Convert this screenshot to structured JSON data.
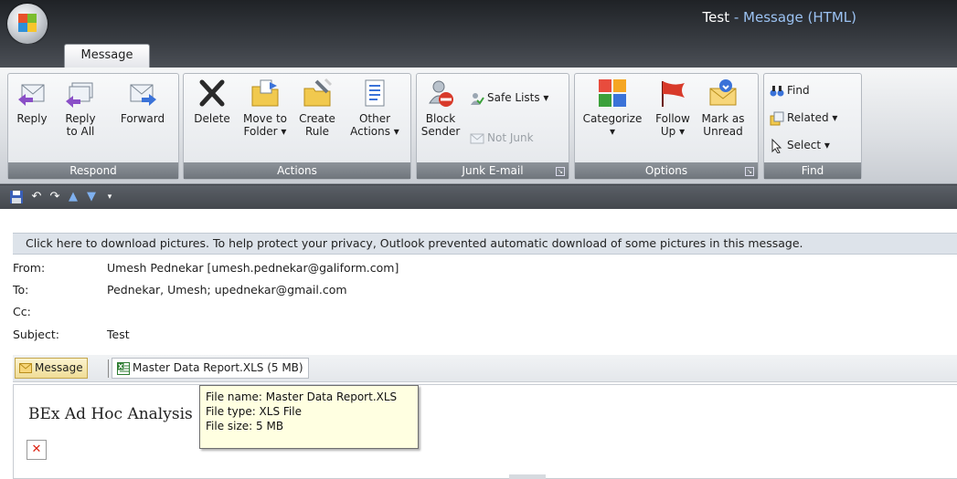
{
  "window": {
    "title_doc": "Test",
    "title_sep": " - ",
    "title_app": "Message (HTML)"
  },
  "tabs": [
    {
      "label": "Message"
    }
  ],
  "ribbon": {
    "groups": {
      "respond": {
        "label": "Respond",
        "reply": "Reply",
        "reply_all_1": "Reply",
        "reply_all_2": "to All",
        "forward": "Forward"
      },
      "actions": {
        "label": "Actions",
        "delete": "Delete",
        "move_1": "Move to",
        "move_2": "Folder ▾",
        "create_1": "Create",
        "create_2": "Rule",
        "other_1": "Other",
        "other_2": "Actions ▾"
      },
      "junk": {
        "label": "Junk E-mail",
        "block_1": "Block",
        "block_2": "Sender",
        "safe_lists": "Safe Lists ▾",
        "not_junk": "Not Junk"
      },
      "options": {
        "label": "Options",
        "categorize": "Categorize",
        "categorize_arrow": "▾",
        "follow_1": "Follow",
        "follow_2": "Up ▾",
        "mark_1": "Mark as",
        "mark_2": "Unread"
      },
      "find": {
        "label": "Find",
        "find": "Find",
        "related": "Related ▾",
        "select": "Select ▾"
      }
    }
  },
  "infobar": {
    "text": "Click here to download pictures. To help protect your privacy, Outlook prevented automatic download of some pictures in this message."
  },
  "headers": {
    "from_label": "From:",
    "from_value": "Umesh Pednekar [umesh.pednekar@galiform.com]",
    "to_label": "To:",
    "to_value": "Pednekar, Umesh; upednekar@gmail.com",
    "cc_label": "Cc:",
    "cc_value": "",
    "subject_label": "Subject:",
    "subject_value": "Test"
  },
  "attachments": {
    "message_tab": "Message",
    "file": "Master Data Report.XLS (5 MB)"
  },
  "body": {
    "text": "BEx Ad Hoc Analysis"
  },
  "tooltip": {
    "line1": "File name:  Master Data Report.XLS",
    "line2": "File type:  XLS File",
    "line3": "File size:  5 MB"
  },
  "colors": {
    "accent": "#9bc2f2",
    "tooltip_bg": "#ffffe1",
    "group_label_bg": "#6f757c"
  }
}
